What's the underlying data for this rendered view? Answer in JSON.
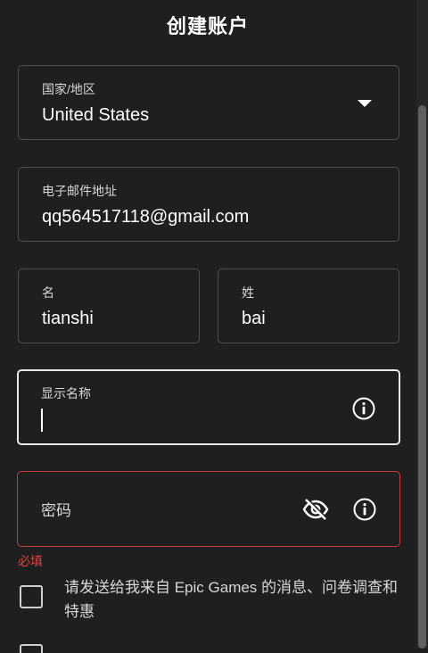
{
  "page": {
    "title": "创建账户"
  },
  "form": {
    "country": {
      "label": "国家/地区",
      "value": "United States"
    },
    "email": {
      "label": "电子邮件地址",
      "value": "qq564517118@gmail.com"
    },
    "first_name": {
      "label": "名",
      "value": "tianshi"
    },
    "last_name": {
      "label": "姓",
      "value": "bai"
    },
    "display_name": {
      "label": "显示名称",
      "value": "",
      "icon": "info-icon"
    },
    "password": {
      "label": "密码",
      "icons": [
        "eye-off-icon",
        "info-icon"
      ],
      "error": "必填"
    },
    "marketing_checkbox": {
      "label": "请发送给我来自 Epic Games 的消息、问卷调查和特惠",
      "checked": false
    }
  },
  "colors": {
    "background": "#1f1f1f",
    "border": "#4d4d4d",
    "focus_border": "#e8e8e8",
    "error": "#d94444"
  }
}
